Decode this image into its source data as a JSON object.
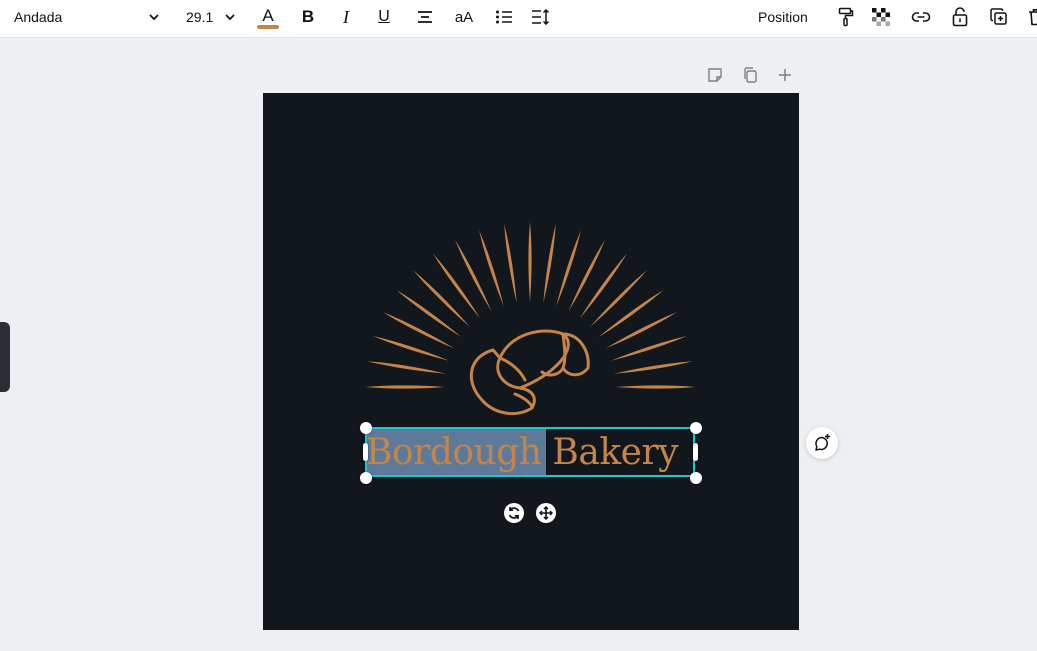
{
  "toolbar": {
    "font_family": "Andada",
    "font_size": "29.1",
    "text_color_letter": "A",
    "text_color": "#c58548",
    "bold_label": "B",
    "italic_label": "I",
    "underline_label": "U",
    "case_label": "aA",
    "position_label": "Position",
    "icons": [
      "chevron-down-icon",
      "align-center-icon",
      "list-icon",
      "line-spacing-icon",
      "paint-roller-icon",
      "transparency-icon",
      "link-icon",
      "lock-icon",
      "duplicate-icon",
      "trash-icon"
    ]
  },
  "page_actions": {
    "icons": [
      "note-icon",
      "copy-page-icon",
      "add-page-icon"
    ]
  },
  "canvas": {
    "background": "#11171d",
    "accent": "#c58548",
    "text_word1": "Bordough",
    "text_word2": " Bakery",
    "selection_color": "#1ec6cf",
    "highlight_color": "#5d7a9a"
  },
  "comment": {
    "icon": "add-comment-icon"
  }
}
